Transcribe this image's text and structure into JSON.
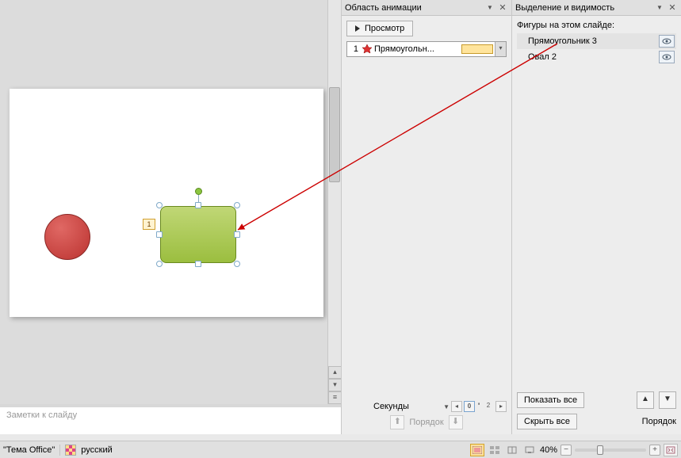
{
  "animation_panel": {
    "title": "Область анимации",
    "preview_label": "Просмотр",
    "item": {
      "num": "1",
      "text": "Прямоугольн..."
    },
    "seconds_label": "Секунды",
    "seconds_ticks": [
      "0",
      "2"
    ],
    "order_label": "Порядок"
  },
  "selection_panel": {
    "title": "Выделение и видимость",
    "caption": "Фигуры на этом слайде:",
    "shapes": [
      {
        "name": "Прямоугольник 3",
        "selected": true
      },
      {
        "name": "Овал 2",
        "selected": false
      }
    ],
    "show_all": "Показать все",
    "hide_all": "Скрыть все",
    "order_label": "Порядок"
  },
  "slide": {
    "animation_tag": "1"
  },
  "notes_placeholder": "Заметки к слайду",
  "statusbar": {
    "theme": "\"Тема Office\"",
    "language": "русский",
    "zoom": "40%"
  }
}
